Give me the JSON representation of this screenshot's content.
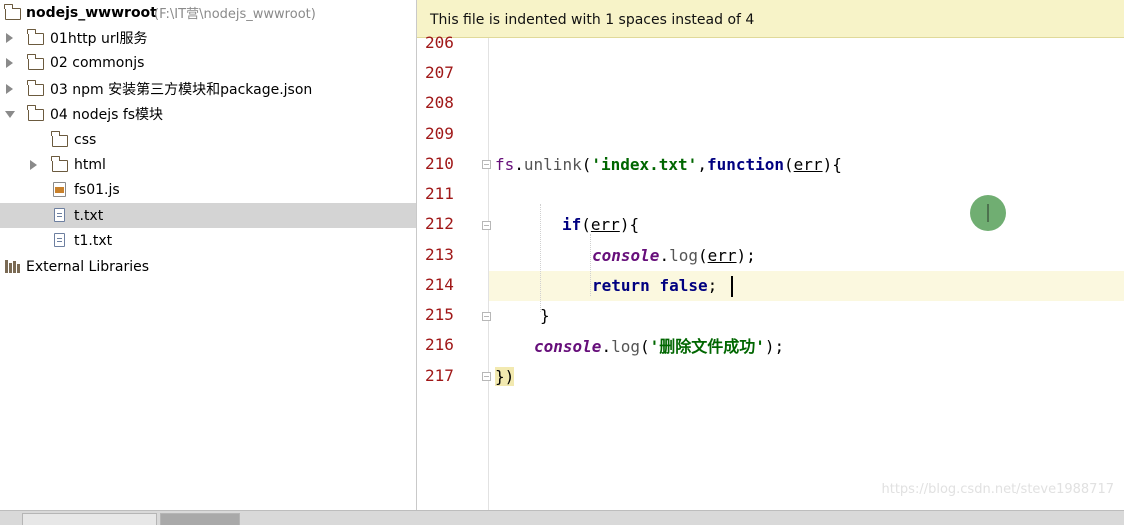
{
  "project": {
    "name": "nodejs_wwwroot",
    "path": "(F:\\IT营\\nodejs_wwwroot)",
    "items": [
      {
        "label": "01http url服务",
        "type": "folder",
        "expanded": false
      },
      {
        "label": "02 commonjs",
        "type": "folder",
        "expanded": false
      },
      {
        "label": "03 npm 安装第三方模块和package.json",
        "type": "folder",
        "expanded": false
      },
      {
        "label": "04 nodejs fs模块",
        "type": "folder",
        "expanded": true
      },
      {
        "label": "css",
        "type": "folder"
      },
      {
        "label": "html",
        "type": "folder",
        "expanded": false
      },
      {
        "label": "fs01.js",
        "type": "js-file"
      },
      {
        "label": "t.txt",
        "type": "text-file",
        "selected": true
      },
      {
        "label": "t1.txt",
        "type": "text-file"
      },
      {
        "label": "External Libraries",
        "type": "library"
      }
    ]
  },
  "editor": {
    "notice": "This file is indented with 1 spaces instead of 4",
    "line_numbers": [
      "206",
      "207",
      "208",
      "209",
      "210",
      "211",
      "212",
      "213",
      "214",
      "215",
      "216",
      "217"
    ],
    "current_line": "214",
    "code": {
      "l210_fs": "fs",
      "l210_dot": ".",
      "l210_unlink": "unlink",
      "l210_paren": "(",
      "l210_str": "'index.txt'",
      "l210_comma": ",",
      "l210_function": "function",
      "l210_args_open": "(",
      "l210_err": "err",
      "l210_args_close": ")",
      "l210_brace": "{",
      "l212_if": "if",
      "l212_open": "(",
      "l212_err": "err",
      "l212_close": ")",
      "l212_brace": "{",
      "l213_console": "console",
      "l213_dot": ".",
      "l213_log": "log",
      "l213_open": "(",
      "l213_err": "err",
      "l213_close": ");",
      "l214_return": "return",
      "l214_false": "false",
      "l214_semi": ";",
      "l215_brace": "}",
      "l216_console": "console",
      "l216_dot": ".",
      "l216_log": "log",
      "l216_open": "(",
      "l216_str": "'删除文件成功'",
      "l216_close": ");",
      "l217_close": "})"
    }
  },
  "watermark": "https://blog.csdn.net/steve1988717",
  "tabs": [
    {
      "label": "",
      "active": false
    },
    {
      "label": "",
      "active": true
    }
  ],
  "colors": {
    "notice_bg": "#f7f3c8",
    "keyword": "#000080",
    "string": "#006600",
    "object": "#660e7a",
    "line_number": "#a01818",
    "current_line_bg": "#fbf8df",
    "selection_bg": "#d4d4d4"
  }
}
